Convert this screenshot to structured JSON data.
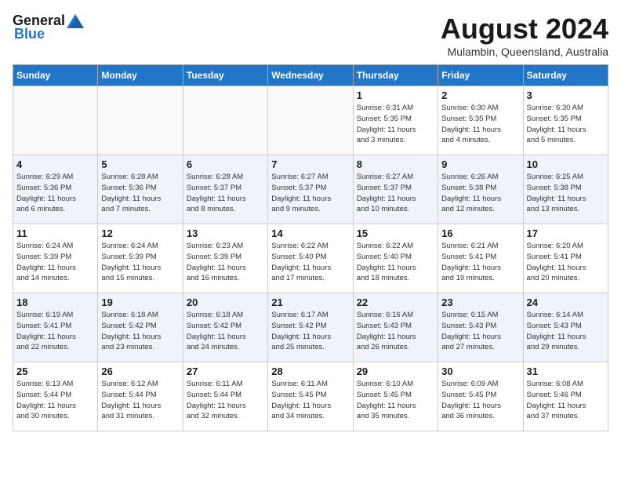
{
  "header": {
    "logo": {
      "general": "General",
      "blue": "Blue"
    },
    "title": "August 2024",
    "location": "Mulambin, Queensland, Australia"
  },
  "calendar": {
    "days": [
      "Sunday",
      "Monday",
      "Tuesday",
      "Wednesday",
      "Thursday",
      "Friday",
      "Saturday"
    ],
    "weeks": [
      {
        "alt": false,
        "cells": [
          {
            "date": "",
            "info": ""
          },
          {
            "date": "",
            "info": ""
          },
          {
            "date": "",
            "info": ""
          },
          {
            "date": "",
            "info": ""
          },
          {
            "date": "1",
            "info": "Sunrise: 6:31 AM\nSunset: 5:35 PM\nDaylight: 11 hours\nand 3 minutes."
          },
          {
            "date": "2",
            "info": "Sunrise: 6:30 AM\nSunset: 5:35 PM\nDaylight: 11 hours\nand 4 minutes."
          },
          {
            "date": "3",
            "info": "Sunrise: 6:30 AM\nSunset: 5:35 PM\nDaylight: 11 hours\nand 5 minutes."
          }
        ]
      },
      {
        "alt": true,
        "cells": [
          {
            "date": "4",
            "info": "Sunrise: 6:29 AM\nSunset: 5:36 PM\nDaylight: 11 hours\nand 6 minutes."
          },
          {
            "date": "5",
            "info": "Sunrise: 6:28 AM\nSunset: 5:36 PM\nDaylight: 11 hours\nand 7 minutes."
          },
          {
            "date": "6",
            "info": "Sunrise: 6:28 AM\nSunset: 5:37 PM\nDaylight: 11 hours\nand 8 minutes."
          },
          {
            "date": "7",
            "info": "Sunrise: 6:27 AM\nSunset: 5:37 PM\nDaylight: 11 hours\nand 9 minutes."
          },
          {
            "date": "8",
            "info": "Sunrise: 6:27 AM\nSunset: 5:37 PM\nDaylight: 11 hours\nand 10 minutes."
          },
          {
            "date": "9",
            "info": "Sunrise: 6:26 AM\nSunset: 5:38 PM\nDaylight: 11 hours\nand 12 minutes."
          },
          {
            "date": "10",
            "info": "Sunrise: 6:25 AM\nSunset: 5:38 PM\nDaylight: 11 hours\nand 13 minutes."
          }
        ]
      },
      {
        "alt": false,
        "cells": [
          {
            "date": "11",
            "info": "Sunrise: 6:24 AM\nSunset: 5:39 PM\nDaylight: 11 hours\nand 14 minutes."
          },
          {
            "date": "12",
            "info": "Sunrise: 6:24 AM\nSunset: 5:39 PM\nDaylight: 11 hours\nand 15 minutes."
          },
          {
            "date": "13",
            "info": "Sunrise: 6:23 AM\nSunset: 5:39 PM\nDaylight: 11 hours\nand 16 minutes."
          },
          {
            "date": "14",
            "info": "Sunrise: 6:22 AM\nSunset: 5:40 PM\nDaylight: 11 hours\nand 17 minutes."
          },
          {
            "date": "15",
            "info": "Sunrise: 6:22 AM\nSunset: 5:40 PM\nDaylight: 11 hours\nand 18 minutes."
          },
          {
            "date": "16",
            "info": "Sunrise: 6:21 AM\nSunset: 5:41 PM\nDaylight: 11 hours\nand 19 minutes."
          },
          {
            "date": "17",
            "info": "Sunrise: 6:20 AM\nSunset: 5:41 PM\nDaylight: 11 hours\nand 20 minutes."
          }
        ]
      },
      {
        "alt": true,
        "cells": [
          {
            "date": "18",
            "info": "Sunrise: 6:19 AM\nSunset: 5:41 PM\nDaylight: 11 hours\nand 22 minutes."
          },
          {
            "date": "19",
            "info": "Sunrise: 6:18 AM\nSunset: 5:42 PM\nDaylight: 11 hours\nand 23 minutes."
          },
          {
            "date": "20",
            "info": "Sunrise: 6:18 AM\nSunset: 5:42 PM\nDaylight: 11 hours\nand 24 minutes."
          },
          {
            "date": "21",
            "info": "Sunrise: 6:17 AM\nSunset: 5:42 PM\nDaylight: 11 hours\nand 25 minutes."
          },
          {
            "date": "22",
            "info": "Sunrise: 6:16 AM\nSunset: 5:43 PM\nDaylight: 11 hours\nand 26 minutes."
          },
          {
            "date": "23",
            "info": "Sunrise: 6:15 AM\nSunset: 5:43 PM\nDaylight: 11 hours\nand 27 minutes."
          },
          {
            "date": "24",
            "info": "Sunrise: 6:14 AM\nSunset: 5:43 PM\nDaylight: 11 hours\nand 29 minutes."
          }
        ]
      },
      {
        "alt": false,
        "cells": [
          {
            "date": "25",
            "info": "Sunrise: 6:13 AM\nSunset: 5:44 PM\nDaylight: 11 hours\nand 30 minutes."
          },
          {
            "date": "26",
            "info": "Sunrise: 6:12 AM\nSunset: 5:44 PM\nDaylight: 11 hours\nand 31 minutes."
          },
          {
            "date": "27",
            "info": "Sunrise: 6:11 AM\nSunset: 5:44 PM\nDaylight: 11 hours\nand 32 minutes."
          },
          {
            "date": "28",
            "info": "Sunrise: 6:11 AM\nSunset: 5:45 PM\nDaylight: 11 hours\nand 34 minutes."
          },
          {
            "date": "29",
            "info": "Sunrise: 6:10 AM\nSunset: 5:45 PM\nDaylight: 11 hours\nand 35 minutes."
          },
          {
            "date": "30",
            "info": "Sunrise: 6:09 AM\nSunset: 5:45 PM\nDaylight: 11 hours\nand 36 minutes."
          },
          {
            "date": "31",
            "info": "Sunrise: 6:08 AM\nSunset: 5:46 PM\nDaylight: 11 hours\nand 37 minutes."
          }
        ]
      }
    ]
  }
}
